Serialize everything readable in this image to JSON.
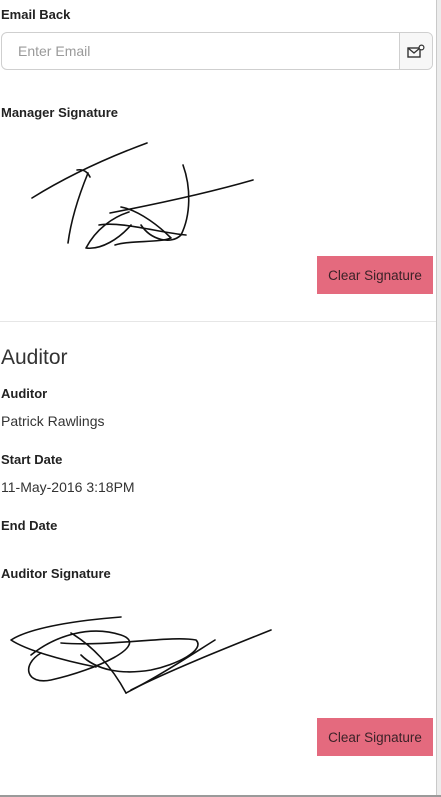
{
  "email_back": {
    "label": "Email Back",
    "placeholder": "Enter Email",
    "value": "",
    "icon": "send-email-icon"
  },
  "manager_signature": {
    "label": "Manager Signature",
    "clear_label": "Clear Signature"
  },
  "auditor_section": {
    "title": "Auditor",
    "auditor_label": "Auditor",
    "auditor_value": "Patrick Rawlings",
    "start_label": "Start Date",
    "start_value": "11-May-2016 3:18PM",
    "end_label": "End Date",
    "end_value": "",
    "signature_label": "Auditor Signature",
    "clear_label": "Clear Signature"
  },
  "colors": {
    "clear_button": "#e46a7e",
    "border": "#cfcfcf"
  }
}
